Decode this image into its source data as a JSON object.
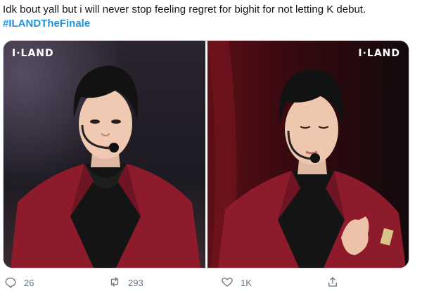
{
  "tweet": {
    "text": "Idk bout yall but i will never stop feeling regret for bighit for not letting K debut.",
    "hashtag": "#ILANDTheFinale"
  },
  "media": {
    "left_watermark": "I·LAND",
    "right_watermark": "I·LAND"
  },
  "actions": {
    "reply_count": "26",
    "retweet_count": "293",
    "like_count": "1K"
  },
  "icons": {
    "reply": "reply-icon",
    "retweet": "retweet-icon",
    "like": "heart-icon",
    "share": "share-icon"
  },
  "colors": {
    "text": "#14171a",
    "hashtag": "#1b95e0",
    "icon": "#657786",
    "jacket": "#8e1b2b"
  }
}
